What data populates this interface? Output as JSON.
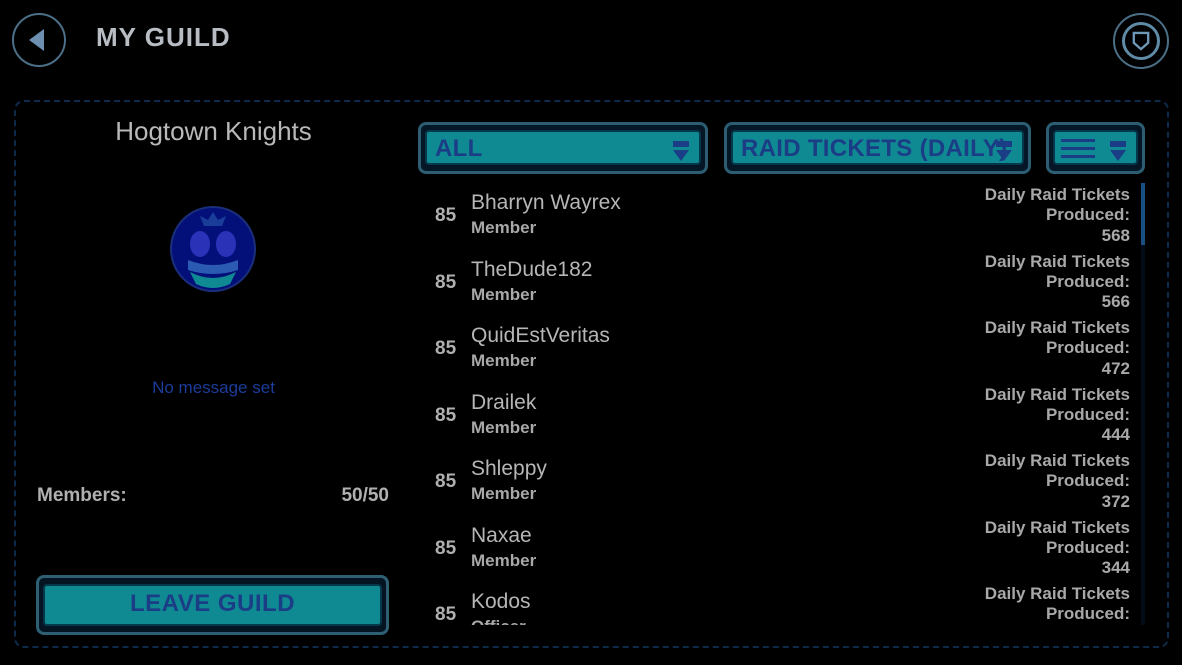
{
  "header": {
    "title": "MY GUILD"
  },
  "guild": {
    "name": "Hogtown Knights",
    "message": "No message set",
    "members_label": "Members:",
    "members_count": "50/50",
    "leave_label": "LEAVE GUILD"
  },
  "filters": {
    "role_filter": "ALL",
    "sort_by": "RAID TICKETS (DAILY)"
  },
  "roster": [
    {
      "level": "85",
      "name": "Bharryn Wayrex",
      "role": "Member",
      "stat_line1": "Daily Raid Tickets",
      "stat_line2": "Produced:",
      "stat_value": "568"
    },
    {
      "level": "85",
      "name": "TheDude182",
      "role": "Member",
      "stat_line1": "Daily Raid Tickets",
      "stat_line2": "Produced:",
      "stat_value": "566"
    },
    {
      "level": "85",
      "name": "QuidEstVeritas",
      "role": "Member",
      "stat_line1": "Daily Raid Tickets",
      "stat_line2": "Produced:",
      "stat_value": "472"
    },
    {
      "level": "85",
      "name": "Drailek",
      "role": "Member",
      "stat_line1": "Daily Raid Tickets",
      "stat_line2": "Produced:",
      "stat_value": "444"
    },
    {
      "level": "85",
      "name": "Shleppy",
      "role": "Member",
      "stat_line1": "Daily Raid Tickets",
      "stat_line2": "Produced:",
      "stat_value": "372"
    },
    {
      "level": "85",
      "name": "Naxae",
      "role": "Member",
      "stat_line1": "Daily Raid Tickets",
      "stat_line2": "Produced:",
      "stat_value": "344"
    },
    {
      "level": "85",
      "name": "Kodos",
      "role": "Officer",
      "stat_line1": "Daily Raid Tickets",
      "stat_line2": "Produced:",
      "stat_value": ""
    }
  ],
  "colors": {
    "button_fill": "#0f8a93",
    "button_text": "#1a3d86",
    "frame": "#2c5d72",
    "accent_blue": "#1b3c9a"
  },
  "icons": {
    "back": "back-arrow-icon",
    "guild": "guild-shield-icon",
    "emblem": "rebel-alliance-emblem",
    "menu": "list-menu-icon",
    "dropdown": "chevron-down-icon"
  }
}
